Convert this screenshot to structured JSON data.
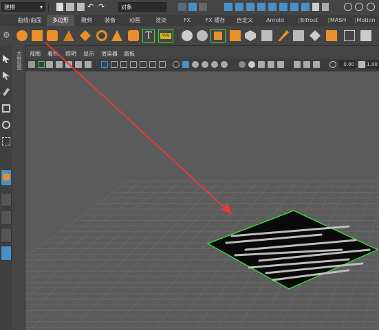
{
  "status_line": {
    "mode_value": "建模",
    "object_field": "对象"
  },
  "shelf_tabs": [
    {
      "label": "曲线/曲面",
      "active": false
    },
    {
      "label": "多边形",
      "active": true
    },
    {
      "label": "雕刻",
      "active": false
    },
    {
      "label": "装备",
      "active": false
    },
    {
      "label": "动画",
      "active": false
    },
    {
      "label": "渲染",
      "active": false
    },
    {
      "label": "FX",
      "active": false
    },
    {
      "label": "FX 缓存",
      "active": false
    },
    {
      "label": "自定义",
      "active": false
    },
    {
      "label": "Arnold",
      "active": false
    },
    {
      "label": "Bifrost",
      "active": false
    },
    {
      "label": "MASH",
      "active": false
    },
    {
      "label": "Motion",
      "active": false
    }
  ],
  "shelf": {
    "text_tool": "T",
    "svg_tool": "SVG"
  },
  "panel_menu": [
    "视图",
    "着色",
    "照明",
    "显示",
    "渲染器",
    "面板"
  ],
  "panel_toolbar": {
    "near_value": "0.00",
    "far_value": "1.00"
  },
  "side_label": "大纲视图",
  "colors": {
    "accent_blue": "#4a90c8",
    "shelf_orange": "#e8902a",
    "selection_green": "#39d339",
    "arrow_red": "#e83a3a",
    "grid_line": "#6b6b6b",
    "grid_bg": "#5c5c5c"
  }
}
